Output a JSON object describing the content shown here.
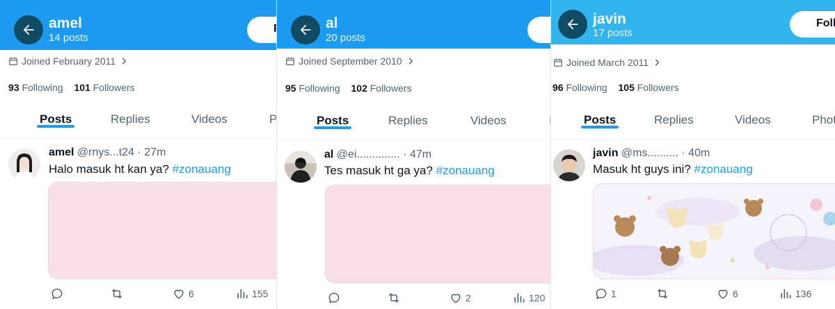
{
  "panels": [
    {
      "header": {
        "name": "amel",
        "posts": "14 posts",
        "follow_label": "F"
      },
      "joined": "Joined February 2011",
      "following_count": "93",
      "following_label": "Following",
      "followers_count": "101",
      "followers_label": "Followers",
      "tabs": [
        "Posts",
        "Replies",
        "Videos",
        "P"
      ],
      "tweet": {
        "name": "amel",
        "handle": "@rnys...t24",
        "time": "· 27m",
        "text": "Halo masuk ht kan ya?",
        "hashtag": "#zonauang",
        "reply_count": "",
        "like_count": "6",
        "views": "155"
      }
    },
    {
      "header": {
        "name": "al",
        "posts": "20 posts",
        "follow_label": ""
      },
      "joined": "Joined September 2010",
      "following_count": "95",
      "following_label": "Following",
      "followers_count": "102",
      "followers_label": "Followers",
      "tabs": [
        "Posts",
        "Replies",
        "Videos",
        "I"
      ],
      "tweet": {
        "name": "al",
        "handle": "@ei..............",
        "time": "· 47m",
        "text": "Tes masuk ht ga ya?",
        "hashtag": "#zonauang",
        "reply_count": "",
        "like_count": "2",
        "views": "120"
      }
    },
    {
      "header": {
        "name": "javin",
        "posts": "17 posts",
        "follow_label": "Foll"
      },
      "joined": "Joined March 2011",
      "following_count": "96",
      "following_label": "Following",
      "followers_count": "105",
      "followers_label": "Followers",
      "tabs": [
        "Posts",
        "Replies",
        "Videos",
        "Phot"
      ],
      "tweet": {
        "name": "javin",
        "handle": "@ms..........",
        "time": "· 40m",
        "text": "Masuk ht guys ini?",
        "hashtag": "#zonauang",
        "reply_count": "1",
        "like_count": "6",
        "views": "136"
      }
    }
  ],
  "colors": {
    "header_blue": "#1d9bf0",
    "header_teal": "#32b4ec",
    "link": "#1d9bf0",
    "media_pink": "#f9e0e8"
  },
  "icons": [
    "arrow-left-icon",
    "calendar-icon",
    "chevron-right-icon",
    "reply-icon",
    "retweet-icon",
    "heart-icon",
    "views-icon"
  ]
}
